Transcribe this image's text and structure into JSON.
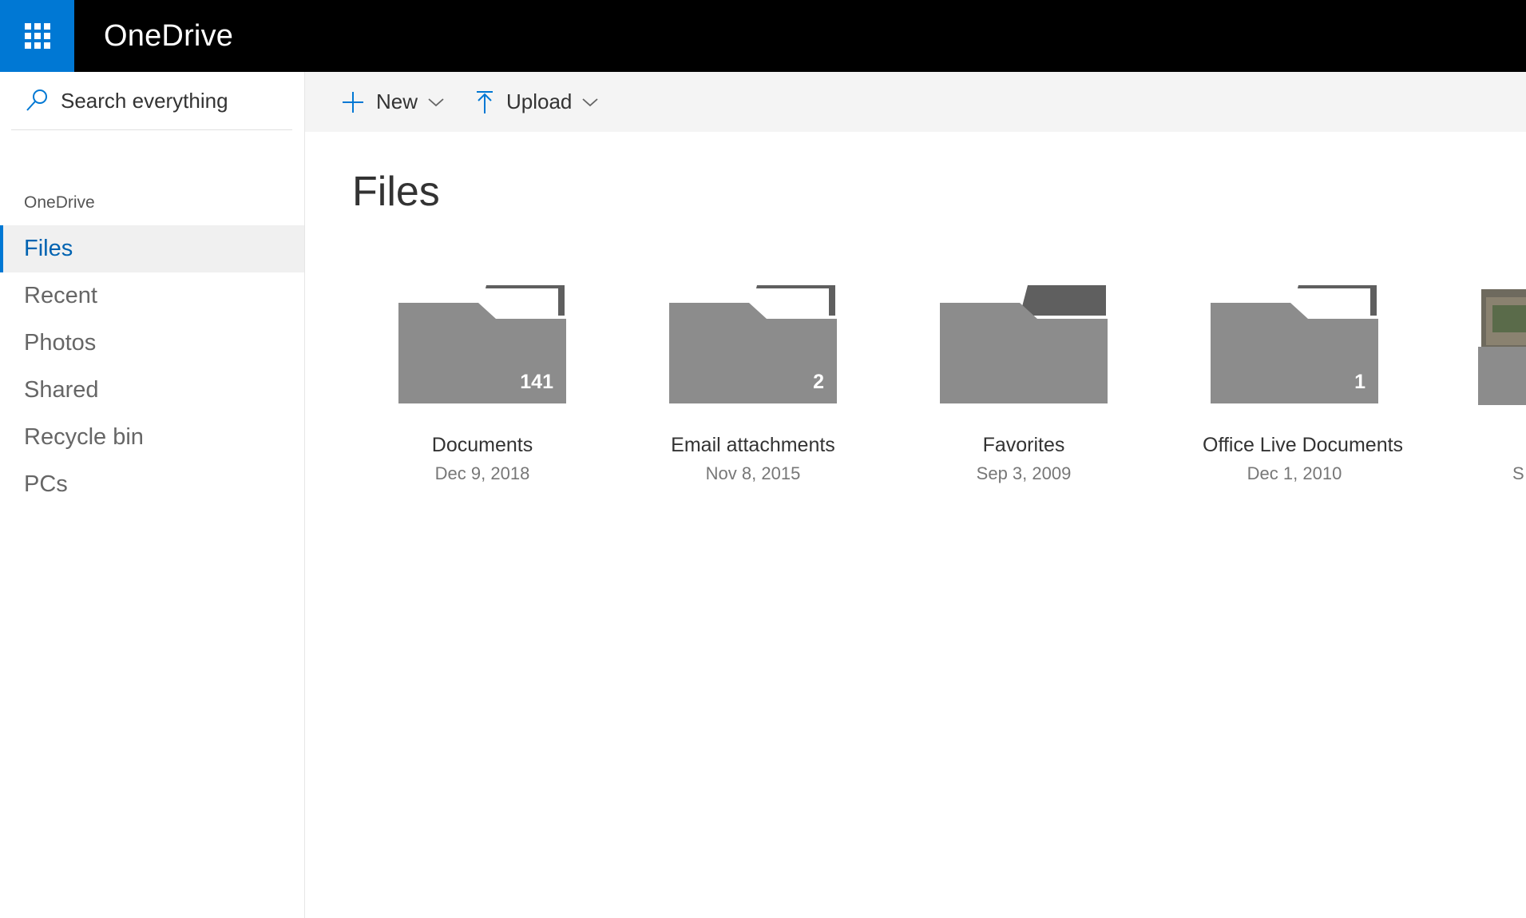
{
  "app": {
    "title": "OneDrive"
  },
  "search": {
    "placeholder": "Search everything"
  },
  "sidebar": {
    "heading": "OneDrive",
    "items": [
      {
        "label": "Files",
        "active": true
      },
      {
        "label": "Recent"
      },
      {
        "label": "Photos"
      },
      {
        "label": "Shared"
      },
      {
        "label": "Recycle bin"
      },
      {
        "label": "PCs"
      }
    ]
  },
  "toolbar": {
    "new_label": "New",
    "upload_label": "Upload"
  },
  "main": {
    "title": "Files",
    "folders": [
      {
        "name": "Documents",
        "date": "Dec 9, 2018",
        "count": "141"
      },
      {
        "name": "Email attachments",
        "date": "Nov 8, 2015",
        "count": "2"
      },
      {
        "name": "Favorites",
        "date": "Sep 3, 2009",
        "count": ""
      },
      {
        "name": "Office Live Documents",
        "date": "Dec 1, 2010",
        "count": "1"
      }
    ],
    "partial_label": "S"
  },
  "colors": {
    "brand": "#0078d4",
    "topbar": "#000000",
    "active_text": "#0063b1"
  }
}
